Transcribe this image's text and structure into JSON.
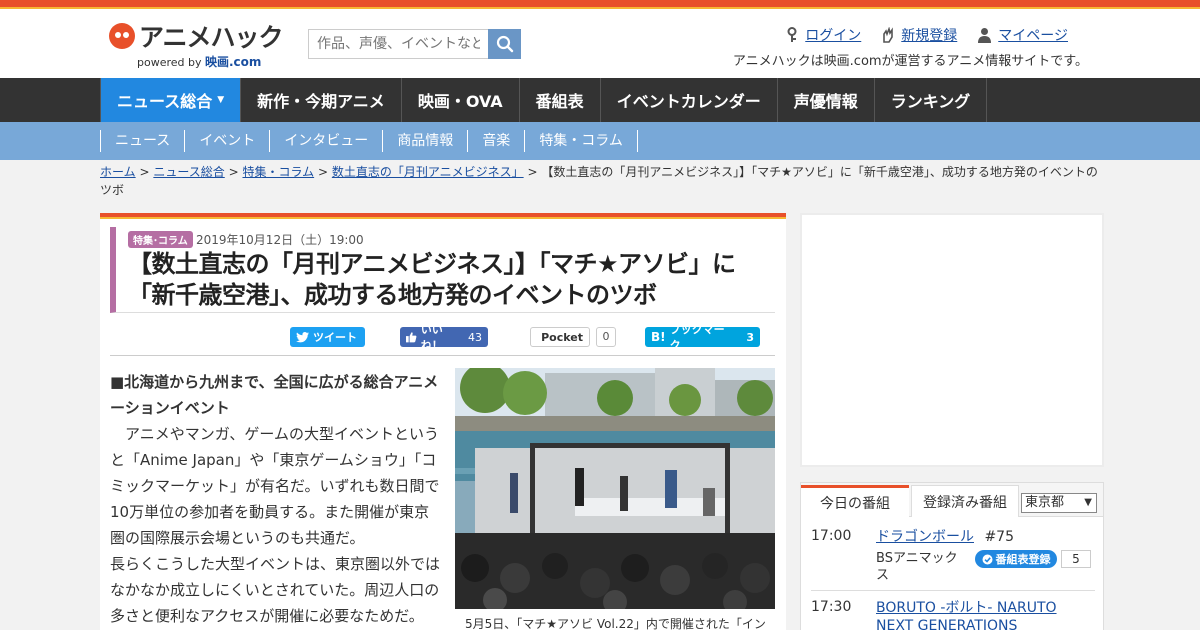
{
  "site": {
    "logo_text": "アニメハック",
    "powered_by": "powered by",
    "powered_brand": "映画.com",
    "tagline": "アニメハックは映画.comが運営するアニメ情報サイトです。"
  },
  "search": {
    "placeholder": "作品、声優、イベントなど"
  },
  "header_links": {
    "login": "ログイン",
    "register": "新規登録",
    "mypage": "マイページ"
  },
  "global_nav": [
    "ニュース総合",
    "新作・今期アニメ",
    "映画・OVA",
    "番組表",
    "イベントカレンダー",
    "声優情報",
    "ランキング"
  ],
  "sub_nav": [
    "ニュース",
    "イベント",
    "インタビュー",
    "商品情報",
    "音楽",
    "特集・コラム"
  ],
  "breadcrumb": {
    "items": [
      "ホーム",
      "ニュース総合",
      "特集・コラム",
      "数土直志の「月刊アニメビジネス」"
    ],
    "separator": ">",
    "current": "【数土直志の「月刊アニメビジネス」】「マチ★アソビ」に「新千歳空港」、成功する地方発のイベントのツボ"
  },
  "article": {
    "category": "特集･コラム",
    "date": "2019年10月12日（土）19:00",
    "title": "【数土直志の「月刊アニメビジネス」】「マチ★アソビ」に「新千歳空港」、成功する地方発のイベントのツボ",
    "heading": "■北海道から九州まで、全国に広がる総合アニメーションイベント",
    "paragraph1": "　アニメやマンガ、ゲームの大型イベントというと「Anime Japan」や「東京ゲームショウ」「コミックマーケット」が有名だ。いずれも数日間で10万単位の参加者を動員する。また開催が東京圏の国際展示会場というのも共通だ。",
    "paragraph2": "長らくこうした大型イベントは、東京圏以外ではなかなか成立しにくいとされていた。周辺人口の多さと便利なアクセスが開催に必要なためだ。",
    "caption": "5月5日、「マチ★アソビ Vol.22」内で開催された「イン"
  },
  "share": {
    "tweet": "ツイート",
    "like": "いいね！",
    "like_count": "43",
    "pocket": "Pocket",
    "pocket_count": "0",
    "hatena": "ブックマーク",
    "hatena_count": "3"
  },
  "tv": {
    "tab_today": "今日の番組",
    "tab_registered": "登録済み番組",
    "region": "東京都",
    "register_label": "番組表登録",
    "programs": [
      {
        "time": "17:00",
        "title": "ドラゴンボール",
        "episode": "#75",
        "channel": "BSアニマックス",
        "count": "5"
      },
      {
        "time": "17:30",
        "title": "BORUTO -ボルト- NARUTO NEXT GENERATIONS"
      }
    ]
  }
}
